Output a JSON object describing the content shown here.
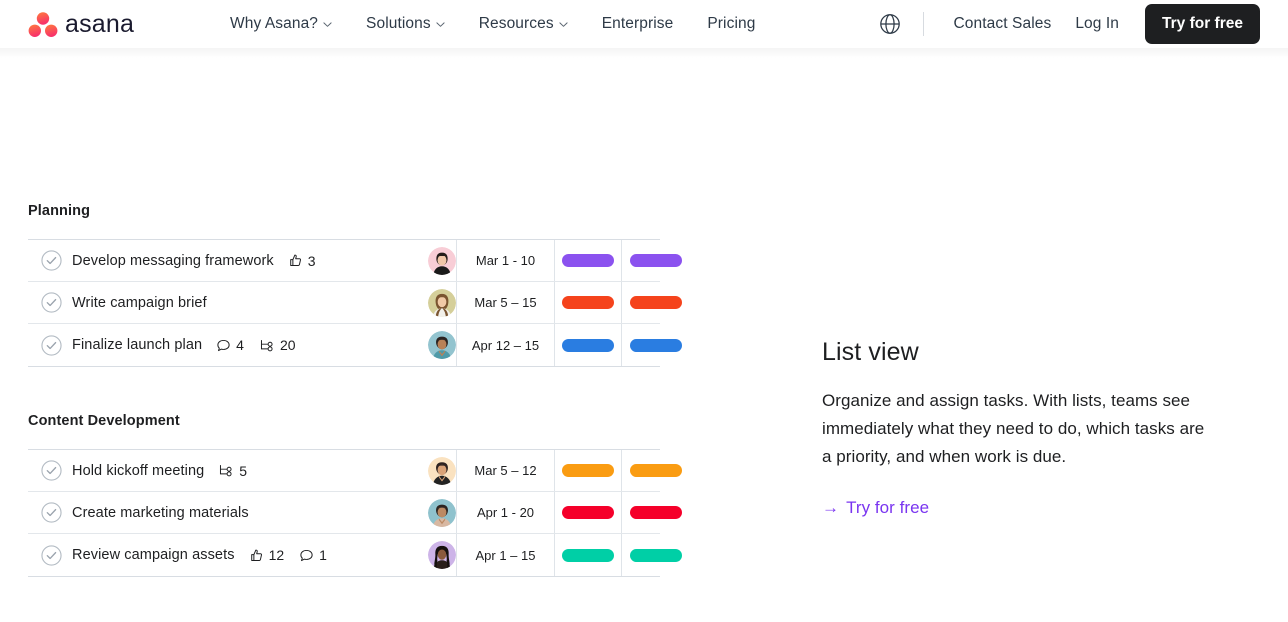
{
  "header": {
    "logo_text": "asana",
    "logo_icon": "asana-logo-dots",
    "nav": [
      {
        "label": "Why Asana?",
        "has_chevron": true
      },
      {
        "label": "Solutions",
        "has_chevron": true
      },
      {
        "label": "Resources",
        "has_chevron": true
      },
      {
        "label": "Enterprise",
        "has_chevron": false
      },
      {
        "label": "Pricing",
        "has_chevron": false
      }
    ],
    "globe_icon": "globe-icon",
    "contact_sales": "Contact Sales",
    "log_in": "Log In",
    "try_free": "Try for free",
    "cta_bg": "#1e1f21"
  },
  "list": {
    "sections": [
      {
        "title": "Planning",
        "rows": [
          {
            "name": "Develop messaging framework",
            "meta": [
              {
                "icon": "thumbs-up-icon",
                "count": "3"
              }
            ],
            "avatar_bg": "#f8cdd6",
            "avatar_skin": "#f0c6a8",
            "avatar_hair": "#241c1a",
            "avatar_shirt": "#1a1a1a",
            "date": "Mar 1 - 10",
            "pill_color": "#8b52ef"
          },
          {
            "name": "Write campaign brief",
            "meta": [],
            "avatar_bg": "#d5cf9a",
            "avatar_skin": "#f0c9a6",
            "avatar_hair": "#7a5430",
            "avatar_shirt": "#f2f0ea",
            "date": "Mar 5 – 15",
            "pill_color": "#f5431c"
          },
          {
            "name": "Finalize launch plan",
            "meta": [
              {
                "icon": "comment-icon",
                "count": "4"
              },
              {
                "icon": "subtask-icon",
                "count": "20"
              }
            ],
            "avatar_bg": "#93c4cf",
            "avatar_skin": "#b98258",
            "avatar_hair": "#2b2320",
            "avatar_shirt": "#4f9aa8",
            "date": "Apr 12 – 15",
            "pill_color": "#2a7de1"
          }
        ]
      },
      {
        "title": "Content Development",
        "rows": [
          {
            "name": "Hold kickoff meeting",
            "meta": [
              {
                "icon": "subtask-icon",
                "count": "5"
              }
            ],
            "avatar_bg": "#fae2c0",
            "avatar_skin": "#d9a277",
            "avatar_hair": "#2e2320",
            "avatar_shirt": "#232323",
            "date": "Mar 5 – 12",
            "pill_color": "#fa9c12"
          },
          {
            "name": "Create marketing materials",
            "meta": [],
            "avatar_bg": "#8fc2cd",
            "avatar_skin": "#bc8a63",
            "avatar_hair": "#2b2320",
            "avatar_shirt": "#d8b8a2",
            "date": "Apr 1 - 20",
            "pill_color": "#f5002a"
          },
          {
            "name": "Review campaign assets",
            "meta": [
              {
                "icon": "thumbs-up-icon",
                "count": "12"
              },
              {
                "icon": "comment-icon",
                "count": "1"
              }
            ],
            "avatar_bg": "#cdb4e8",
            "avatar_skin": "#8a5a3c",
            "avatar_hair": "#15100e",
            "avatar_shirt": "#2a1f1a",
            "date": "Apr 1 – 15",
            "pill_color": "#00cfa6"
          }
        ]
      }
    ]
  },
  "copy": {
    "title": "List view",
    "body": "Organize and assign tasks. With lists, teams see immediately what they need to do, which tasks are a priority, and when work is due.",
    "link_arrow": "→",
    "link_label": "Try for free",
    "link_color": "#7a35f0"
  }
}
